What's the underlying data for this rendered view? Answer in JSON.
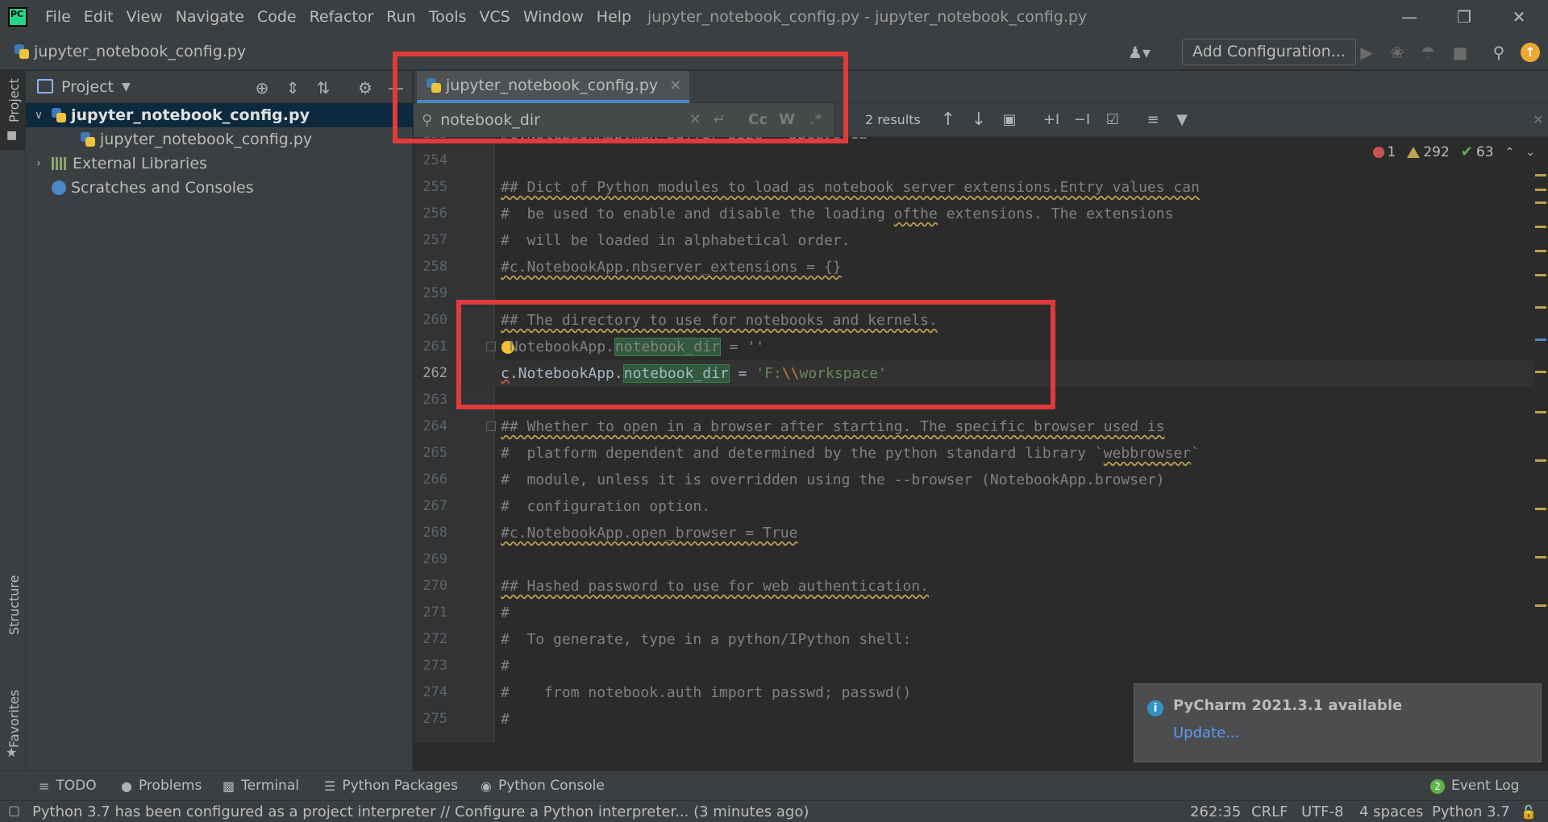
{
  "menubar": {
    "logo_text": "PC",
    "items": [
      "File",
      "Edit",
      "View",
      "Navigate",
      "Code",
      "Refactor",
      "Run",
      "Tools",
      "VCS",
      "Window",
      "Help"
    ],
    "window_title": "jupyter_notebook_config.py - jupyter_notebook_config.py"
  },
  "navbar": {
    "file": "jupyter_notebook_config.py",
    "add_configuration": "Add Configuration..."
  },
  "leftstrip": {
    "project": "Project",
    "structure": "Structure",
    "favorites": "Favorites"
  },
  "project_panel": {
    "title": "Project",
    "tree": [
      {
        "label": "jupyter_notebook_config.py",
        "selected": true,
        "bold": true
      },
      {
        "label": "jupyter_notebook_config.py",
        "selected": false,
        "bold": false
      },
      {
        "label": "External Libraries",
        "selected": false,
        "bold": false
      },
      {
        "label": "Scratches and Consoles",
        "selected": false,
        "bold": false
      }
    ]
  },
  "editor_tab": {
    "label": "jupyter_notebook_config.py"
  },
  "search": {
    "query": "notebook_dir",
    "results": "2 results",
    "match_case": "Cc",
    "words": "W",
    "regex": ".*"
  },
  "inspections": {
    "errors": "1",
    "warnings": "292",
    "weak": "63"
  },
  "notification": {
    "title": "PyCharm 2021.3.1 available",
    "link": "Update..."
  },
  "tool_windows": {
    "todo": "TODO",
    "problems": "Problems",
    "terminal": "Terminal",
    "python_packages": "Python Packages",
    "python_console": "Python Console",
    "event_log": "Event Log",
    "event_log_count": "2"
  },
  "status": {
    "message": "Python 3.7 has been configured as a project interpreter // Configure a Python interpreter... (3 minutes ago)",
    "position": "262:35",
    "line_sep": "CRLF",
    "encoding": "UTF-8",
    "indent": "4 spaces",
    "interpreter": "Python 3.7"
  },
  "colors": {
    "accent": "#4a88c7",
    "annotation": "#e03a3a",
    "match_highlight": "#32593d"
  }
}
